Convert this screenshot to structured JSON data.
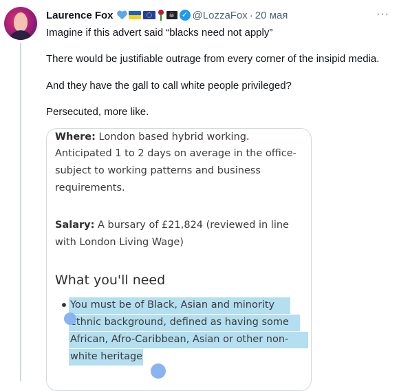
{
  "author": {
    "name": "Laurence Fox",
    "handle": "@LozzaFox",
    "separator": "·",
    "time": "20 мая",
    "badges": [
      "blue-heart-icon",
      "ukraine-flag-icon",
      "eu-flag-icon",
      "red-rose-icon",
      "pirate-flag-icon",
      "verified-badge-icon"
    ]
  },
  "more_label": "···",
  "tweet": {
    "paragraphs": [
      "Imagine if this advert said “blacks need not apply”",
      "There would be justifiable outrage from every corner of the insipid media.",
      "And they have the gall to call white people privileged?",
      "Persecuted, more like."
    ]
  },
  "media": {
    "where_label": "Where:",
    "where_lines": [
      " London based hybrid working.",
      "Anticipated 1 to 2 days on average in the office-",
      "subject to working patterns and business",
      "requirements."
    ],
    "salary_label": "Salary:",
    "salary_lines": [
      " A bursary of £21,824 (reviewed in line",
      "with London Living Wage)"
    ],
    "heading": "What you'll need",
    "bullet_lines": [
      "You must be of Black, Asian and minority",
      "ethnic background, defined as having some",
      "African, Afro-Caribbean, Asian or other non-",
      "white heritage"
    ],
    "highlight_color": "#b4dff0"
  }
}
